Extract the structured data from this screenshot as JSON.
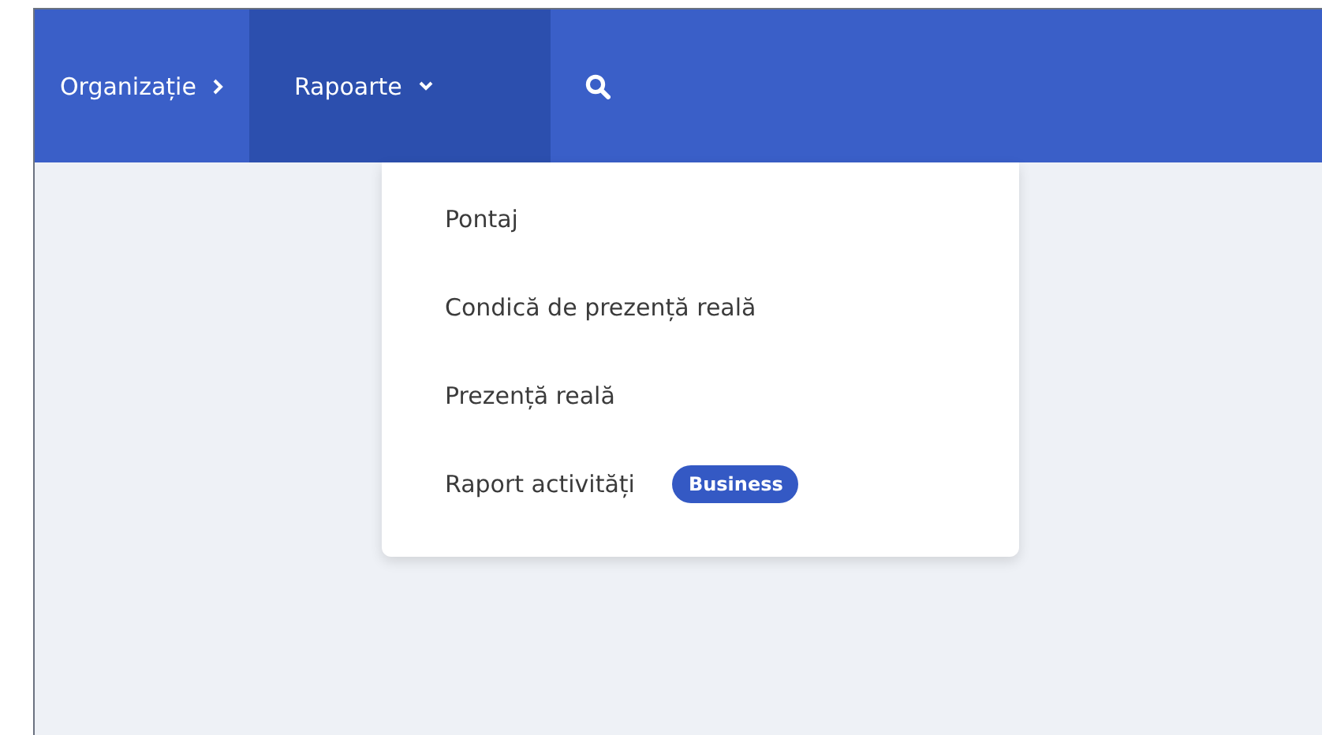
{
  "nav": {
    "items": [
      {
        "label": "Organizație",
        "kind": "arrow",
        "selected": false
      },
      {
        "label": "Rapoarte",
        "kind": "dropdown",
        "selected": true
      },
      {
        "kind": "search",
        "selected": false
      }
    ]
  },
  "menu": {
    "items": [
      {
        "label": "Pontaj"
      },
      {
        "label": "Condică de prezență reală"
      },
      {
        "label": "Prezență reală"
      },
      {
        "label": "Raport activități",
        "badge": "Business"
      }
    ]
  }
}
